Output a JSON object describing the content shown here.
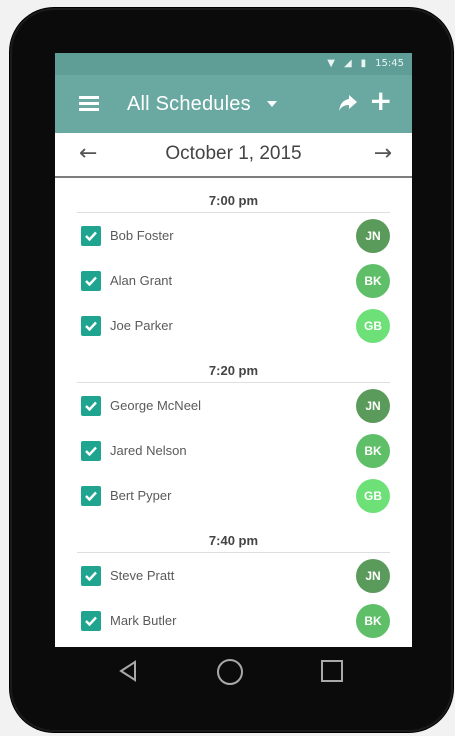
{
  "status_bar": {
    "icons": [
      "wifi-icon",
      "signal-icon",
      "battery-icon"
    ],
    "time": "15:45"
  },
  "app_bar": {
    "title": "All Schedules",
    "icons": [
      "menu-icon",
      "dropdown-caret-icon",
      "share-icon",
      "add-icon"
    ],
    "add_glyph": "+"
  },
  "date_bar": {
    "date": "October 1, 2015",
    "prev_glyph": "←",
    "next_glyph": "→"
  },
  "colors": {
    "app_bar": "#6aa9a1",
    "status_bar": "#5f9e96",
    "checkbox": "#1fa58f",
    "avatar_jn": "#5a9a5a",
    "avatar_bk": "#5fbf68",
    "avatar_gb": "#6de078"
  },
  "slots": [
    {
      "time": "7:00 pm",
      "entries": [
        {
          "name": "Bob Foster",
          "initials": "JN",
          "color": "#5a9a5a",
          "checked": true
        },
        {
          "name": "Alan Grant",
          "initials": "BK",
          "color": "#5fbf68",
          "checked": true
        },
        {
          "name": "Joe Parker",
          "initials": "GB",
          "color": "#6de078",
          "checked": true
        }
      ]
    },
    {
      "time": "7:20 pm",
      "entries": [
        {
          "name": "George McNeel",
          "initials": "JN",
          "color": "#5a9a5a",
          "checked": true
        },
        {
          "name": "Jared Nelson",
          "initials": "BK",
          "color": "#5fbf68",
          "checked": true
        },
        {
          "name": "Bert Pyper",
          "initials": "GB",
          "color": "#6de078",
          "checked": true
        }
      ]
    },
    {
      "time": "7:40 pm",
      "entries": [
        {
          "name": "Steve Pratt",
          "initials": "JN",
          "color": "#5a9a5a",
          "checked": true
        },
        {
          "name": "Mark Butler",
          "initials": "BK",
          "color": "#5fbf68",
          "checked": true
        }
      ]
    }
  ],
  "nav_bar": {
    "icons": [
      "back-icon",
      "home-icon",
      "recents-icon"
    ]
  }
}
